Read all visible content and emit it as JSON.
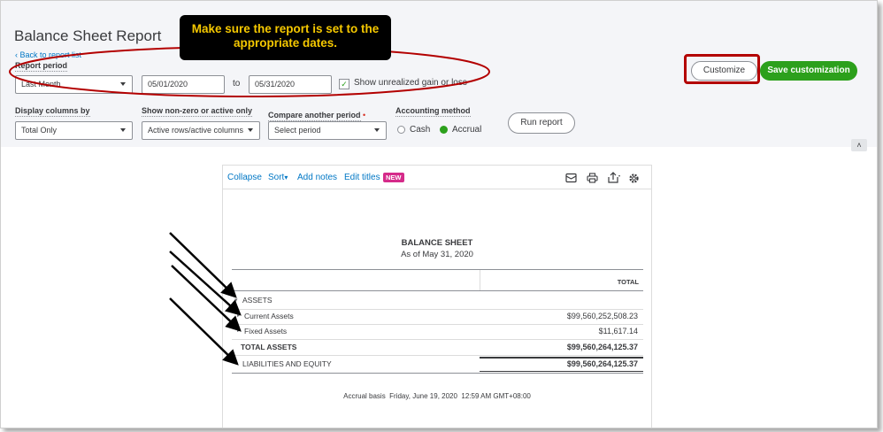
{
  "page": {
    "title": "Balance Sheet Report",
    "back_link": "Back to report list"
  },
  "callout": {
    "text": "Make sure the report is set to the appropriate dates."
  },
  "filters": {
    "report_period_label": "Report period",
    "report_period_value": "Last Month",
    "date_from": "05/01/2020",
    "to_label": "to",
    "date_to": "05/31/2020",
    "unrealized_label": "Show unrealized gain or loss",
    "unrealized_checked": true,
    "display_columns_label": "Display columns by",
    "display_columns_value": "Total Only",
    "nonzero_label": "Show non-zero or active only",
    "nonzero_value": "Active rows/active columns",
    "compare_label": "Compare another period",
    "compare_value": "Select period",
    "accounting_label": "Accounting method",
    "cash_label": "Cash",
    "accrual_label": "Accrual",
    "accounting_selected": "Accrual"
  },
  "actions": {
    "customize": "Customize",
    "save_customization": "Save customization",
    "run_report": "Run report"
  },
  "report_toolbar": {
    "collapse": "Collapse",
    "sort": "Sort",
    "add_notes": "Add notes",
    "edit_titles": "Edit titles",
    "new_badge": "NEW",
    "icons": [
      "email-icon",
      "print-icon",
      "export-icon",
      "settings-icon"
    ]
  },
  "report": {
    "title": "BALANCE SHEET",
    "subtitle": "As of May 31, 2020",
    "column_header": "TOTAL",
    "rows": [
      {
        "label": "ASSETS",
        "amount": ""
      },
      {
        "label": "Current Assets",
        "amount": "$99,560,252,508.23"
      },
      {
        "label": "Fixed Assets",
        "amount": "$11,617.14"
      },
      {
        "label": "TOTAL ASSETS",
        "amount": "$99,560,264,125.37"
      },
      {
        "label": "LIABILITIES AND EQUITY",
        "amount": "$99,560,264,125.37"
      }
    ],
    "footer": "Accrual basis  Friday, June 19, 2020  12:59 AM GMT+08:00"
  },
  "colors": {
    "accent_green": "#2ca01c",
    "link_blue": "#0077c5",
    "annotation_red": "#b30000",
    "callout_yellow": "#f5c800",
    "badge_pink": "#d52b8a"
  }
}
